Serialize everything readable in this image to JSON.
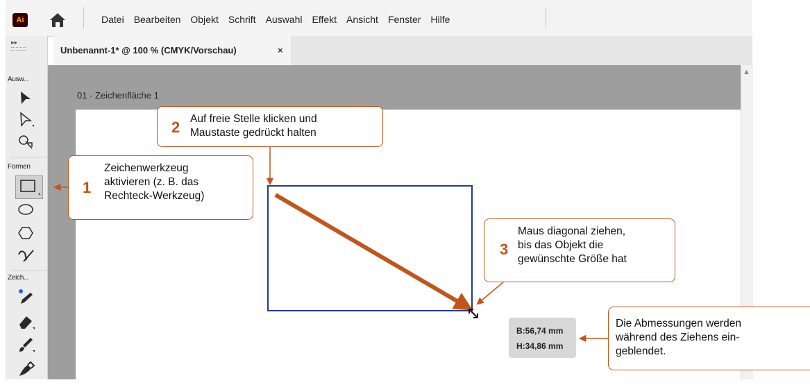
{
  "app": {
    "logo_text": "Ai",
    "menu": [
      "Datei",
      "Bearbeiten",
      "Objekt",
      "Schrift",
      "Auswahl",
      "Effekt",
      "Ansicht",
      "Fenster",
      "Hilfe"
    ]
  },
  "document": {
    "tab_title": "Unbenannt-1* @ 100 % (CMYK/Vorschau)",
    "tab_close": "×",
    "artboard_label": "01 - Zeichenfläche 1"
  },
  "toolbar": {
    "expand": "▸▸",
    "group_select": "Ausw...",
    "group_shapes": "Formen",
    "group_draw": "Zeich..."
  },
  "tooltip": {
    "width": "B:56,74 mm",
    "height": "H:34,86 mm"
  },
  "callouts": {
    "c1": {
      "num": "1",
      "lines": [
        "Zeichenwerkzeug",
        "aktivieren (z. B. das",
        "Rechteck-Werkzeug)"
      ]
    },
    "c2": {
      "num": "2",
      "lines": [
        "Auf freie Stelle klicken und",
        "Maustaste gedrückt halten"
      ]
    },
    "c3": {
      "num": "3",
      "lines": [
        "Maus diagonal ziehen,",
        "bis das Objekt die",
        "gewünschte Größe hat"
      ]
    },
    "c4": {
      "lines": [
        "Die Abmessungen werden",
        "während des Ziehens ein-",
        "geblendet."
      ]
    }
  },
  "colors": {
    "accent": "#c0561b",
    "rect_stroke": "#1f3c8c",
    "logo_bg": "#330000",
    "logo_fg": "#ff9a00"
  }
}
